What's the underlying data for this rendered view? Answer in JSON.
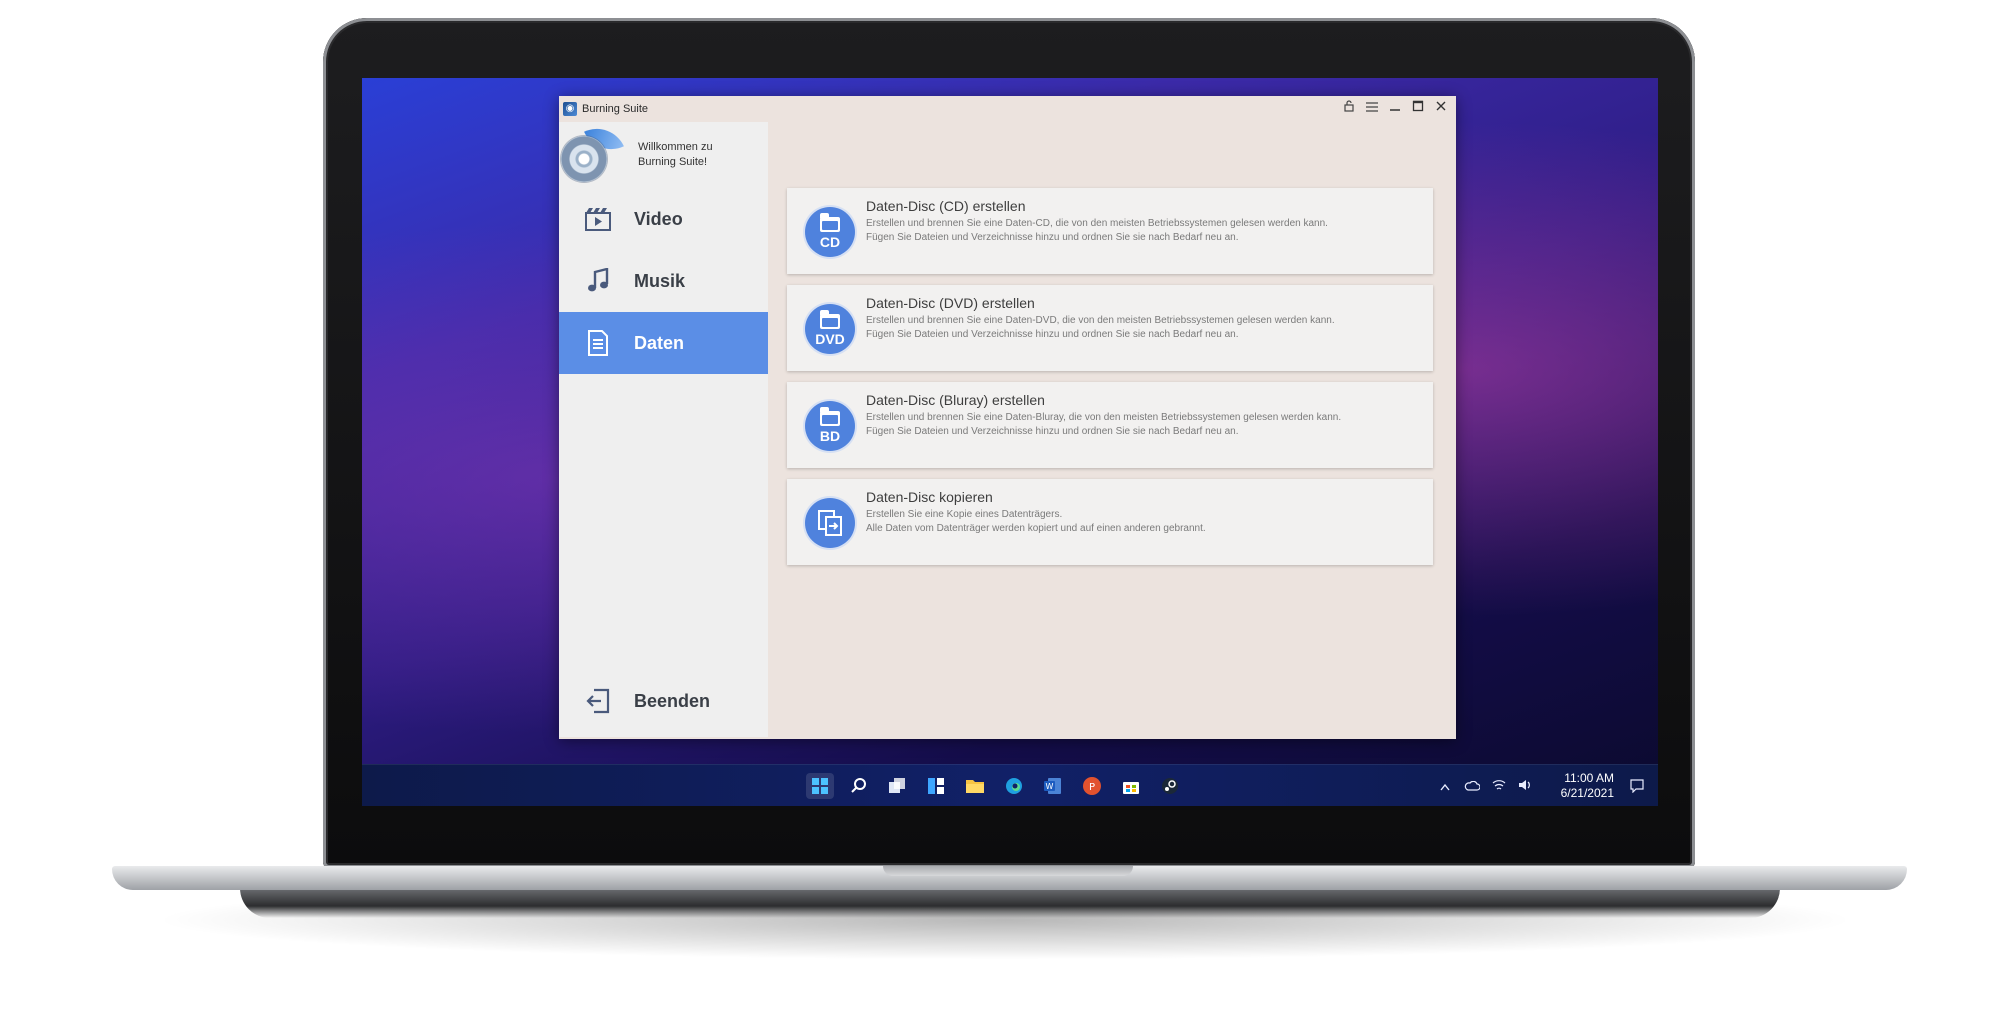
{
  "window": {
    "title": "Burning Suite",
    "controls": [
      "lock-icon",
      "menu-icon",
      "minimize-icon",
      "maximize-icon",
      "close-icon"
    ]
  },
  "sidebar": {
    "welcome_line1": "Willkommen zu",
    "welcome_line2": "Burning Suite!",
    "items": [
      {
        "label": "Video",
        "icon": "video-icon",
        "active": false
      },
      {
        "label": "Musik",
        "icon": "music-icon",
        "active": false
      },
      {
        "label": "Daten",
        "icon": "document-icon",
        "active": true
      }
    ],
    "exit_label": "Beenden"
  },
  "cards": [
    {
      "title": "Daten-Disc (CD) erstellen",
      "line1": "Erstellen und brennen Sie eine Daten-CD, die von den meisten Betriebssystemen gelesen werden kann.",
      "line2": "Fügen Sie Dateien und Verzeichnisse hinzu und ordnen Sie sie nach Bedarf neu an.",
      "badge": "CD"
    },
    {
      "title": "Daten-Disc (DVD) erstellen",
      "line1": "Erstellen und brennen Sie eine Daten-DVD, die von den meisten Betriebssystemen gelesen werden kann.",
      "line2": "Fügen Sie Dateien und Verzeichnisse hinzu und ordnen Sie sie nach Bedarf neu an.",
      "badge": "DVD"
    },
    {
      "title": "Daten-Disc (Bluray) erstellen",
      "line1": "Erstellen und brennen Sie eine Daten-Bluray, die von den meisten Betriebssystemen gelesen werden kann.",
      "line2": "Fügen Sie Dateien und Verzeichnisse hinzu und ordnen Sie sie nach Bedarf neu an.",
      "badge": "BD"
    },
    {
      "title": "Daten-Disc kopieren",
      "line1": "Erstellen Sie eine Kopie eines Datenträgers.",
      "line2": "Alle Daten vom Datenträger werden kopiert und auf einen anderen gebrannt.",
      "badge": ""
    }
  ],
  "taskbar": {
    "time": "11:00 AM",
    "date": "6/21/2021",
    "apps": [
      "start-icon",
      "search-icon",
      "task-view-icon",
      "widgets-icon",
      "file-explorer-icon",
      "edge-icon",
      "word-icon",
      "powerpoint-icon",
      "store-icon",
      "steam-icon"
    ]
  },
  "colors": {
    "accent": "#5b8ee6",
    "card_icon": "#4f82dd",
    "app_background": "#ece3de",
    "sidebar_background": "#efefef"
  }
}
